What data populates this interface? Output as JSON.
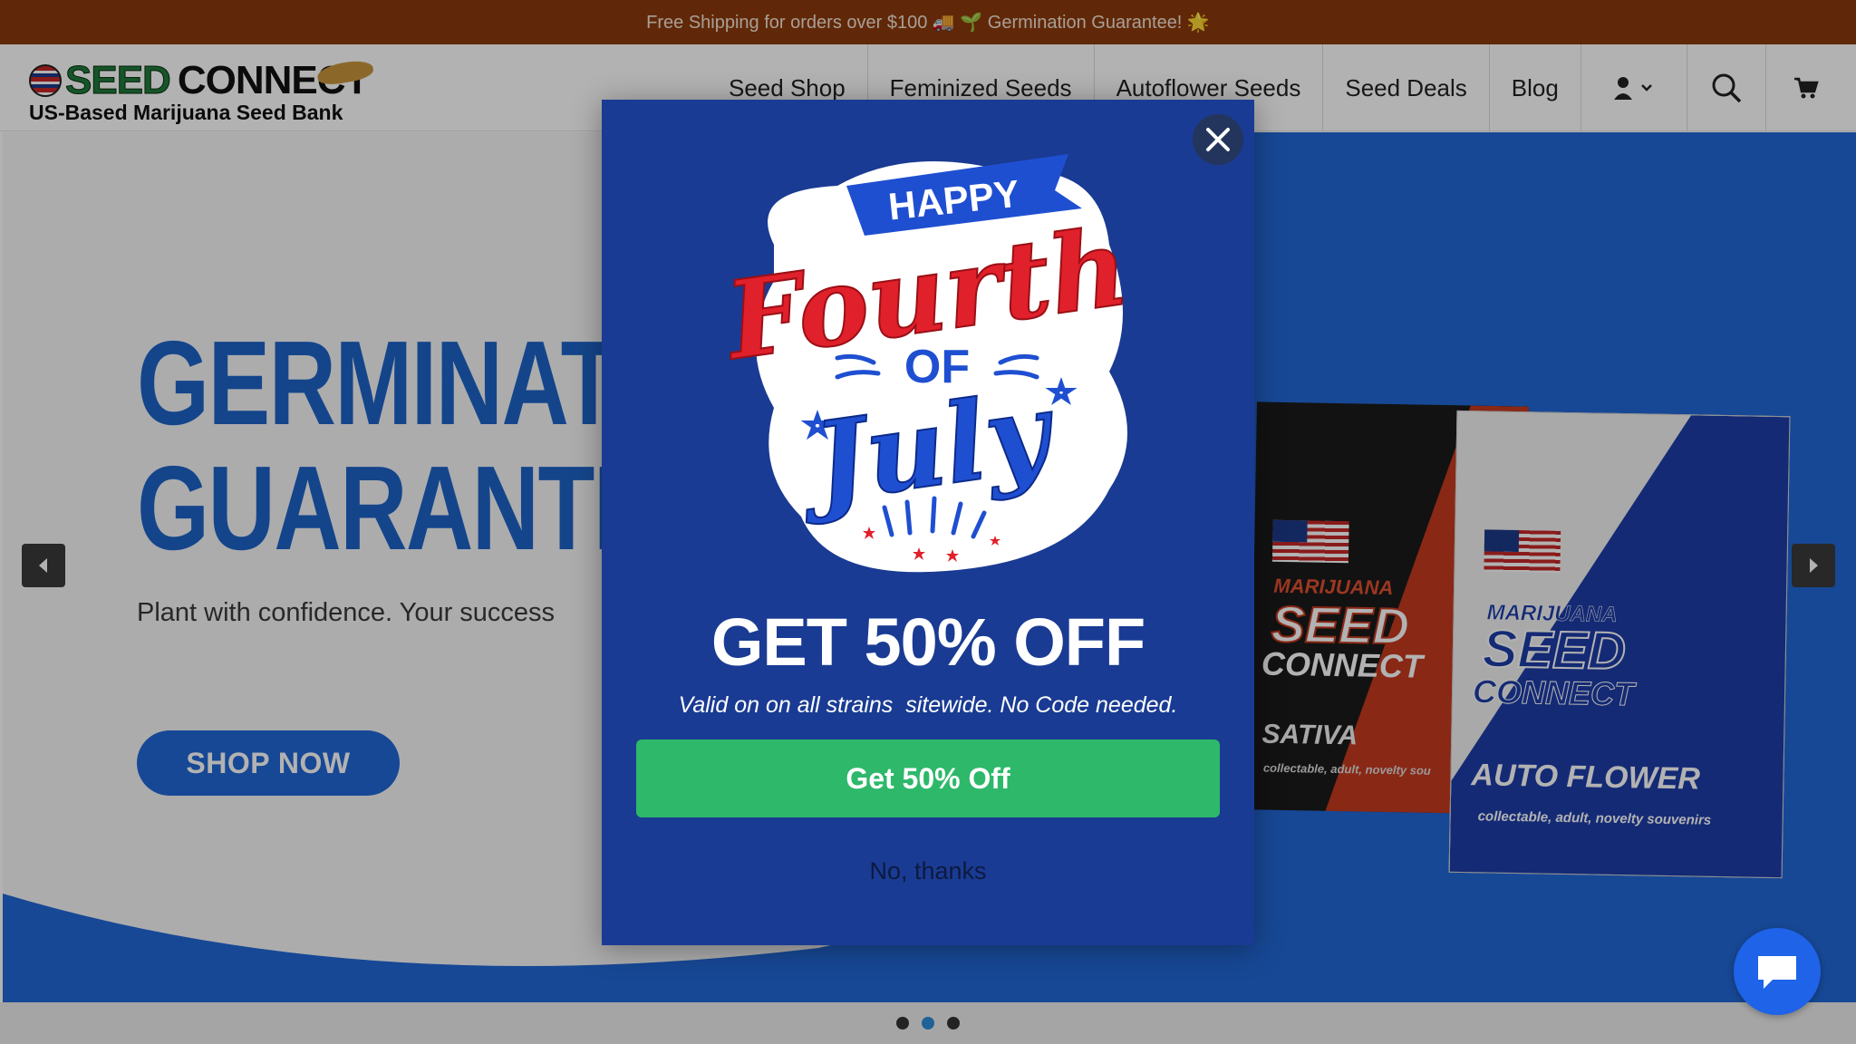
{
  "announcement": {
    "text": "Free Shipping for orders over $100 🚚 🌱 Germination Guarantee! 🌟",
    "lead_icon": "sparkle-icon"
  },
  "header": {
    "logo": {
      "brand_word1": "SEED",
      "brand_word2": "CONNECT",
      "tagline": "US-Based Marijuana Seed Bank"
    },
    "nav": [
      {
        "label": "Seed Shop"
      },
      {
        "label": "Feminized Seeds"
      },
      {
        "label": "Autoflower Seeds"
      },
      {
        "label": "Seed Deals"
      },
      {
        "label": "Blog"
      }
    ],
    "icons": [
      "account-icon",
      "search-icon",
      "cart-icon"
    ]
  },
  "hero": {
    "title_line1": "GERMINATION",
    "title_line2": "GUARANTEE",
    "subtitle": "Plant with confidence. Your success",
    "cta_label": "SHOP NOW",
    "pack1": {
      "line1": "MARIJUANA",
      "line2": "SEED",
      "line3": "CONNECT",
      "type": "SATIVA",
      "small": "collectable, adult, novelty sou"
    },
    "pack2": {
      "line1": "MARIJUANA",
      "line2": "SEED",
      "line3": "CONNECT",
      "type": "AUTO FLOWER",
      "small": "collectable, adult, novelty souvenirs"
    },
    "slide_count": 3,
    "active_slide": 2
  },
  "modal": {
    "badge": {
      "happy": "HAPPY",
      "fourth": "Fourth",
      "of": "OF",
      "july": "July"
    },
    "title": "GET 50% OFF",
    "subtitle": "Valid on on all strains  sitewide. No Code needed.",
    "button_label": "Get 50% Off",
    "decline_label": "No, thanks"
  },
  "colors": {
    "announce_bg": "#8a3a0c",
    "modal_bg": "#1a3b93",
    "cta_green": "#2db86a",
    "hero_blue": "#1e63c8",
    "chat_blue": "#1e63e8"
  }
}
